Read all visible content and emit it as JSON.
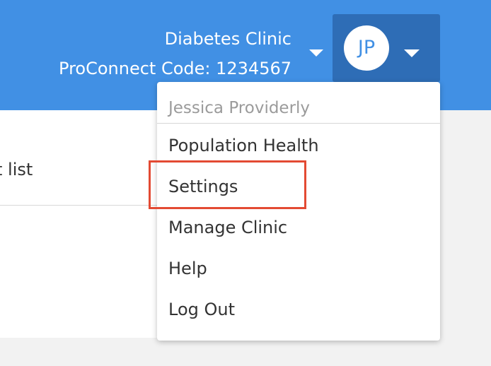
{
  "header": {
    "clinic_name": "Diabetes Clinic",
    "proconnect_code": "ProConnect Code: 1234567",
    "avatar_initials": "JP"
  },
  "background": {
    "partial_label": "t list"
  },
  "dropdown": {
    "user_name": "Jessica Providerly",
    "items": [
      {
        "label": "Population Health"
      },
      {
        "label": "Settings"
      },
      {
        "label": "Manage Clinic"
      },
      {
        "label": "Help"
      },
      {
        "label": "Log Out"
      }
    ]
  },
  "colors": {
    "header_bg": "#4190e4",
    "user_button_bg": "#2e6db6",
    "highlight": "#e34a33"
  }
}
